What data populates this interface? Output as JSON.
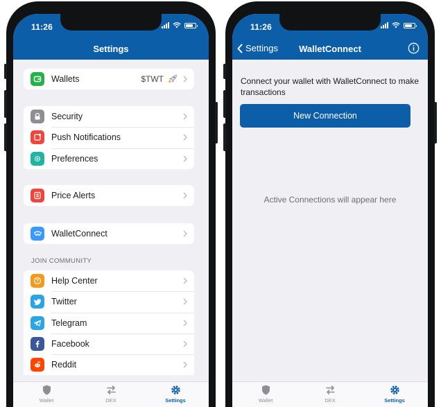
{
  "colors": {
    "nav_blue": "#0d5ea8",
    "wallets_green": "#26b24a",
    "security_gray": "#8e8e93",
    "push_red": "#f0453a",
    "prefs_teal": "#1fb5a0",
    "price_red": "#f0453a",
    "walletconnect_blue": "#3b99fc",
    "help_orange": "#f39a1e",
    "twitter_blue": "#2aa4e6",
    "telegram_blue": "#2ca6de",
    "facebook_blue": "#3b5998",
    "reddit_red": "#ff4500"
  },
  "status_bar": {
    "time": "11:26"
  },
  "left_screen": {
    "title": "Settings",
    "groups": [
      {
        "items": [
          {
            "label": "Wallets",
            "value": "$TWT",
            "icon": "wallet-icon",
            "badge_icon": "rocket-icon"
          }
        ]
      },
      {
        "items": [
          {
            "label": "Security",
            "icon": "lock-icon"
          },
          {
            "label": "Push Notifications",
            "icon": "notification-icon"
          },
          {
            "label": "Preferences",
            "icon": "gear-icon"
          }
        ]
      },
      {
        "items": [
          {
            "label": "Price Alerts",
            "icon": "dollar-icon"
          }
        ]
      },
      {
        "items": [
          {
            "label": "WalletConnect",
            "icon": "walletconnect-icon"
          }
        ]
      }
    ],
    "community_header": "JOIN COMMUNITY",
    "community": [
      {
        "label": "Help Center",
        "icon": "help-icon"
      },
      {
        "label": "Twitter",
        "icon": "twitter-icon"
      },
      {
        "label": "Telegram",
        "icon": "telegram-icon"
      },
      {
        "label": "Facebook",
        "icon": "facebook-icon"
      },
      {
        "label": "Reddit",
        "icon": "reddit-icon"
      }
    ]
  },
  "right_screen": {
    "back_label": "Settings",
    "title": "WalletConnect",
    "intro_text": "Connect your wallet with WalletConnect to make transactions",
    "new_connection_label": "New Connection",
    "empty_text": "Active Connections will appear here"
  },
  "tabbar": {
    "tabs": [
      {
        "label": "Wallet",
        "icon": "shield-icon",
        "active": false
      },
      {
        "label": "DEX",
        "icon": "swap-icon",
        "active": false
      },
      {
        "label": "Settings",
        "icon": "gear-icon",
        "active": true
      }
    ]
  }
}
